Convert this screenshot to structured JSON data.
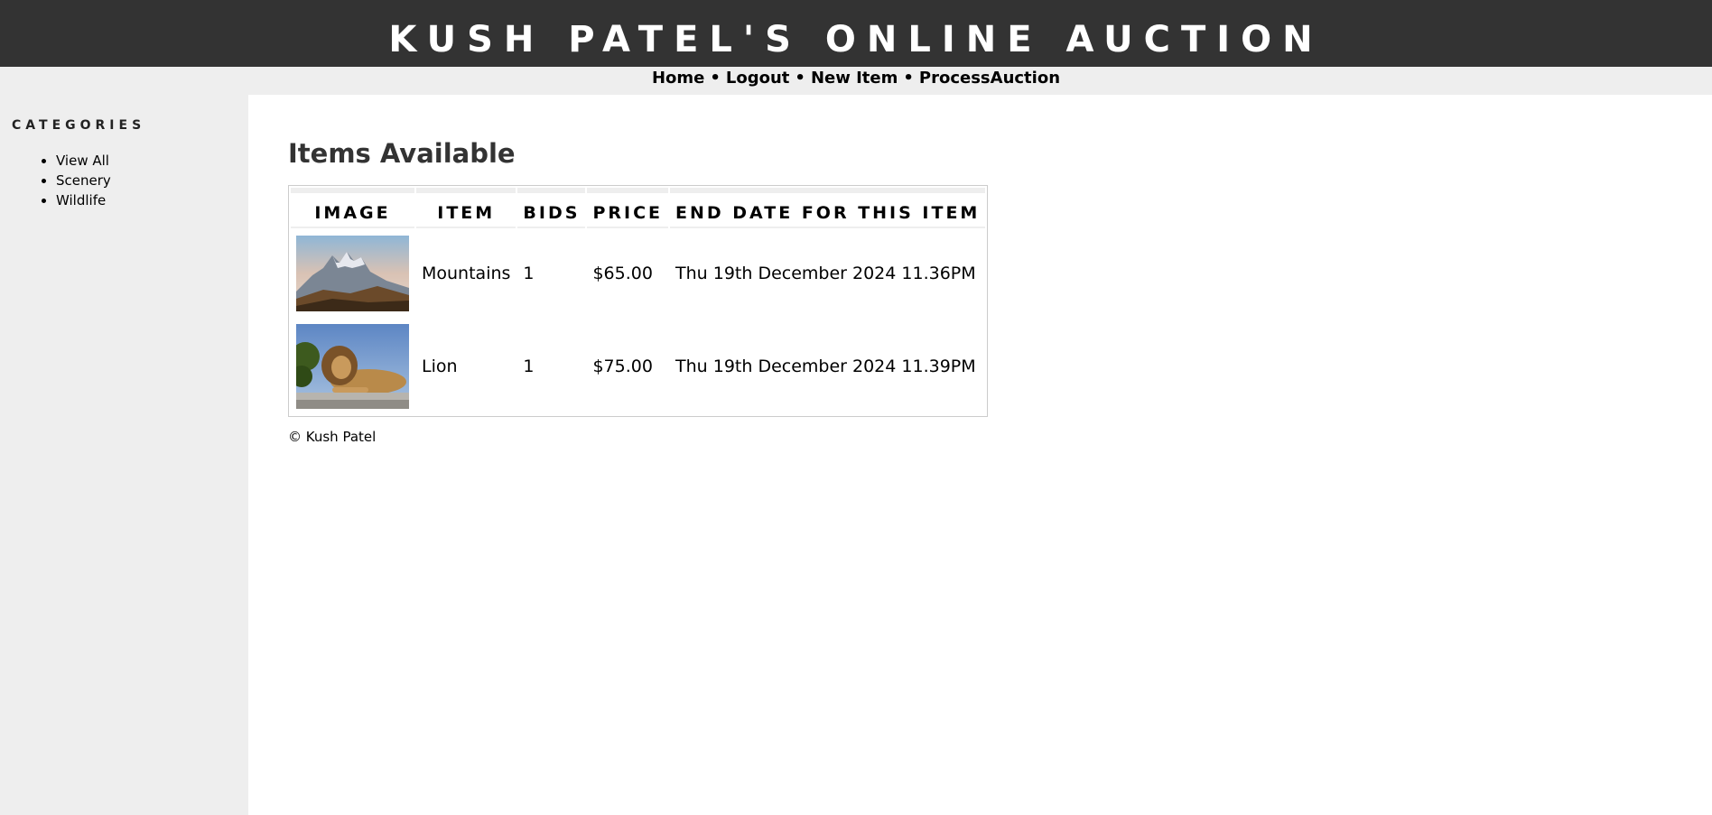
{
  "site": {
    "title": "KUSH PATEL'S ONLINE AUCTION"
  },
  "nav": {
    "items": [
      {
        "label": "Home"
      },
      {
        "label": "Logout"
      },
      {
        "label": "New Item"
      },
      {
        "label": "ProcessAuction"
      }
    ],
    "separator": "•"
  },
  "sidebar": {
    "heading": "CATEGORIES",
    "items": [
      {
        "label": "View All"
      },
      {
        "label": "Scenery"
      },
      {
        "label": "Wildlife"
      }
    ]
  },
  "main": {
    "heading": "Items Available",
    "table": {
      "headers": [
        "IMAGE",
        "ITEM",
        "BIDS",
        "PRICE",
        "END DATE FOR THIS ITEM"
      ],
      "rows": [
        {
          "image": "mountains-photo",
          "item": "Mountains",
          "bids": "1",
          "price": "$65.00",
          "end_date": "Thu 19th December 2024 11.36PM"
        },
        {
          "image": "lion-photo",
          "item": "Lion",
          "bids": "1",
          "price": "$75.00",
          "end_date": "Thu 19th December 2024 11.39PM"
        }
      ]
    }
  },
  "footer": {
    "text": "© Kush Patel"
  },
  "colors": {
    "header_bg": "#333333",
    "nav_bg": "#eeeeee",
    "sidebar_bg": "#eeeeee",
    "heading_text": "#333333"
  }
}
